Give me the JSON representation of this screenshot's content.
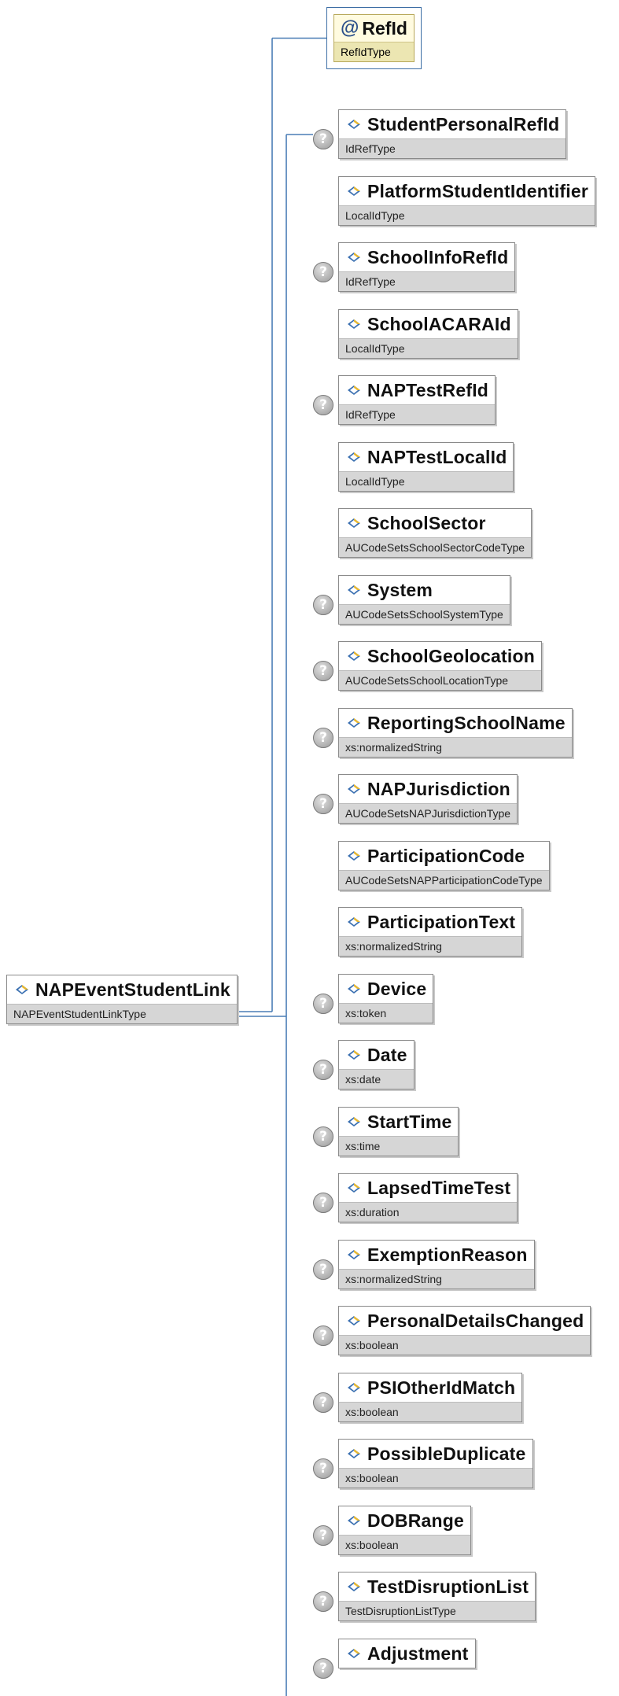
{
  "attribute": {
    "name": "RefId",
    "type": "RefIdType"
  },
  "root": {
    "name": "NAPEventStudentLink",
    "type": "NAPEventStudentLinkType"
  },
  "icons": {
    "element": "element-diamond-icon",
    "attribute": "at-sign-icon",
    "optional": "question-mark-icon"
  },
  "colors": {
    "connector": "#4a7db5",
    "type_band": "#d6d6d6",
    "attribute_border": "#3d6ea5"
  },
  "children": [
    {
      "name": "StudentPersonalRefId",
      "type": "IdRefType",
      "optional": true
    },
    {
      "name": "PlatformStudentIdentifier",
      "type": "LocalIdType",
      "optional": false
    },
    {
      "name": "SchoolInfoRefId",
      "type": "IdRefType",
      "optional": true
    },
    {
      "name": "SchoolACARAId",
      "type": "LocalIdType",
      "optional": false
    },
    {
      "name": "NAPTestRefId",
      "type": "IdRefType",
      "optional": true
    },
    {
      "name": "NAPTestLocalId",
      "type": "LocalIdType",
      "optional": false
    },
    {
      "name": "SchoolSector",
      "type": "AUCodeSetsSchoolSectorCodeType",
      "optional": false
    },
    {
      "name": "System",
      "type": "AUCodeSetsSchoolSystemType",
      "optional": true
    },
    {
      "name": "SchoolGeolocation",
      "type": "AUCodeSetsSchoolLocationType",
      "optional": true
    },
    {
      "name": "ReportingSchoolName",
      "type": "xs:normalizedString",
      "optional": true
    },
    {
      "name": "NAPJurisdiction",
      "type": "AUCodeSetsNAPJurisdictionType",
      "optional": true
    },
    {
      "name": "ParticipationCode",
      "type": "AUCodeSetsNAPParticipationCodeType",
      "optional": false
    },
    {
      "name": "ParticipationText",
      "type": "xs:normalizedString",
      "optional": false
    },
    {
      "name": "Device",
      "type": "xs:token",
      "optional": true
    },
    {
      "name": "Date",
      "type": "xs:date",
      "optional": true
    },
    {
      "name": "StartTime",
      "type": "xs:time",
      "optional": true
    },
    {
      "name": "LapsedTimeTest",
      "type": "xs:duration",
      "optional": true
    },
    {
      "name": "ExemptionReason",
      "type": "xs:normalizedString",
      "optional": true
    },
    {
      "name": "PersonalDetailsChanged",
      "type": "xs:boolean",
      "optional": true
    },
    {
      "name": "PSIOtherIdMatch",
      "type": "xs:boolean",
      "optional": true
    },
    {
      "name": "PossibleDuplicate",
      "type": "xs:boolean",
      "optional": true
    },
    {
      "name": "DOBRange",
      "type": "xs:boolean",
      "optional": true
    },
    {
      "name": "TestDisruptionList",
      "type": "TestDisruptionListType",
      "optional": true
    },
    {
      "name": "Adjustment",
      "type": "",
      "optional": true
    }
  ]
}
